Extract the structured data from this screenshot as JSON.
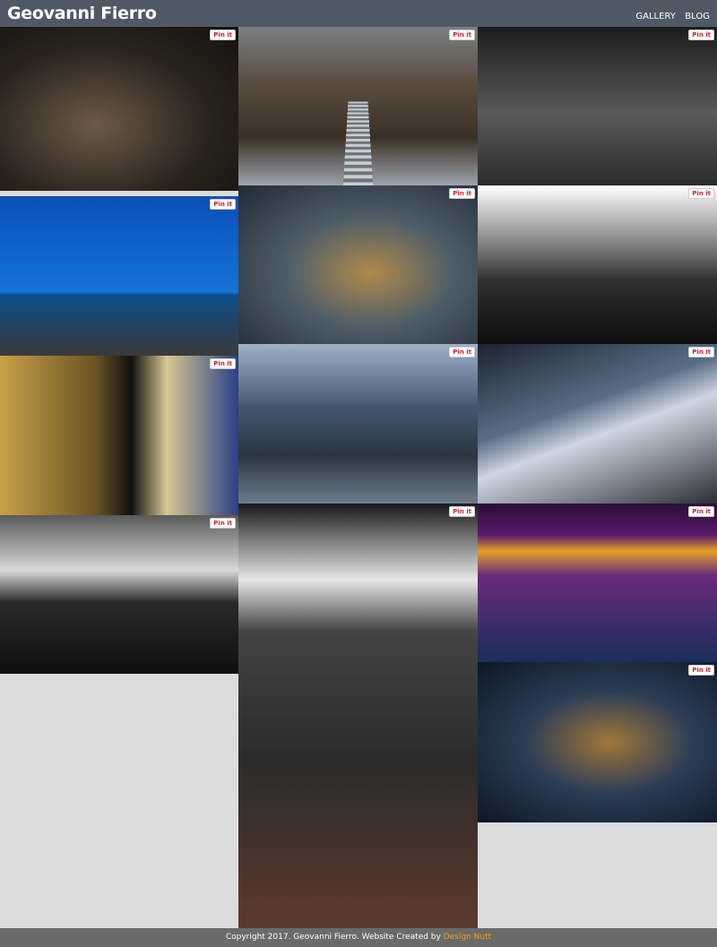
{
  "header": {
    "site_title": "Geovanni Fierro",
    "nav": [
      "GALLERY",
      "BLOG"
    ]
  },
  "gallery": {
    "pin_label": "Pin it",
    "tiles": [
      {
        "name": "sparrow-photo"
      },
      {
        "name": "boardwalk-stairs-photo"
      },
      {
        "name": "windmill-skyline-photo"
      },
      {
        "name": "lighthouse-pier-photo"
      },
      {
        "name": "lion-rocks-photo"
      },
      {
        "name": "skyscrapers-bw-photo"
      },
      {
        "name": "train-platform-photo"
      },
      {
        "name": "river-bridges-photo"
      },
      {
        "name": "riverwalk-underpass-photo"
      },
      {
        "name": "lake-skyline-bw-photo"
      },
      {
        "name": "subway-car-photo"
      },
      {
        "name": "light-trails-photo"
      },
      {
        "name": "lion-night-photo"
      }
    ]
  },
  "footer": {
    "text": "Copyright 2017. Geovanni Fierro. Website Created by ",
    "link": "Design Nutt"
  }
}
